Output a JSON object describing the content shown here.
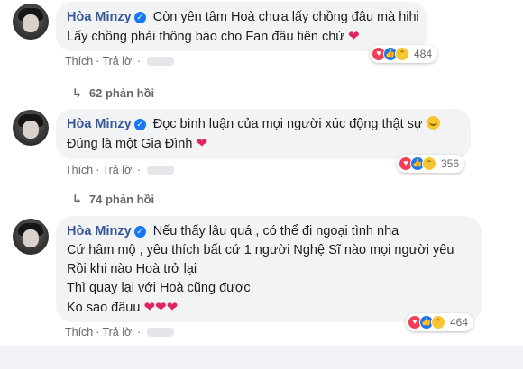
{
  "comments": [
    {
      "author": "Hòa Minzy",
      "lines": [
        "Còn yên tâm Hoà chưa lấy chồng đâu mà hihi",
        "Lấy chồng phải thông báo cho Fan đầu tiên chứ"
      ],
      "reaction_count": "484",
      "like_label": "Thích",
      "reply_label": "Trả lời",
      "replies_label": "62 phản hồi"
    },
    {
      "author": "Hòa Minzy",
      "lines": [
        "Đọc bình luận của mọi người xúc động thật sự",
        "Đúng là một Gia Đình"
      ],
      "reaction_count": "356",
      "like_label": "Thích",
      "reply_label": "Trả lời",
      "replies_label": "74 phản hồi"
    },
    {
      "author": "Hòa Minzy",
      "lines": [
        "Nếu thấy lâu quá , có thể đi ngoại tình nha",
        "Cứ hâm mộ , yêu thích bất cứ 1 người Nghệ Sĩ nào mọi người yêu",
        "Rồi khi nào Hoà trở lại",
        "Thì quay lại với Hoà cũng được",
        "Ko sao đâuu"
      ],
      "reaction_count": "464",
      "like_label": "Thích",
      "reply_label": "Trả lời"
    }
  ],
  "colors": {
    "author": "#385898",
    "bubble": "#f2f3f5",
    "heart": "#e0245e",
    "love": "#f33e58",
    "like": "#1877f2",
    "haha": "#f7c531"
  },
  "icons": {
    "verified": "verified-badge-icon",
    "heart": "heart-emoji-icon",
    "smile": "smile-emoji-icon",
    "reply_arrow": "reply-arrow-icon"
  }
}
